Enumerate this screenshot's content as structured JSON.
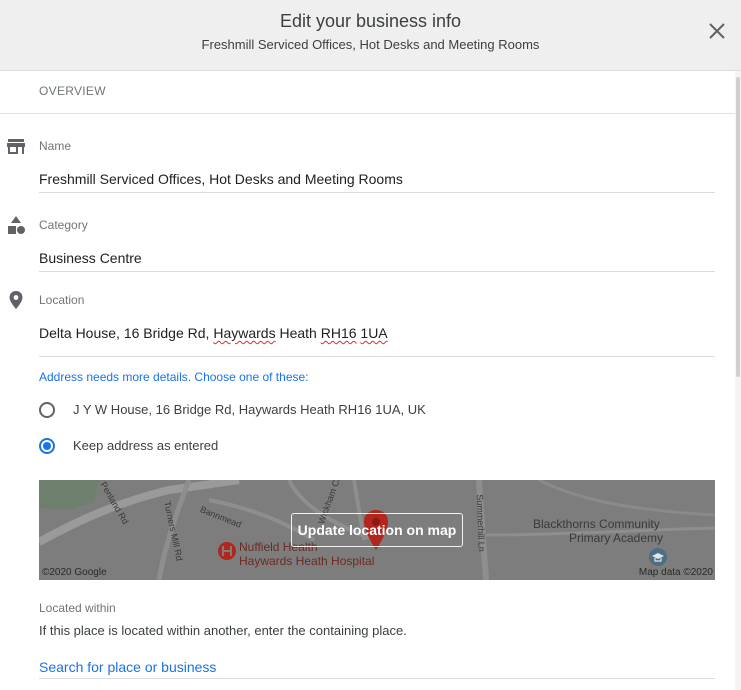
{
  "dialog": {
    "title": "Edit your business info",
    "subtitle": "Freshmill Serviced Offices, Hot Desks and Meeting Rooms",
    "close_icon": "close-icon"
  },
  "section": {
    "label": "OVERVIEW"
  },
  "name_field": {
    "label": "Name",
    "value": "Freshmill Serviced Offices, Hot Desks and Meeting Rooms",
    "icon": "storefront-icon"
  },
  "category_field": {
    "label": "Category",
    "value": "Business Centre",
    "icon": "category-shapes-icon"
  },
  "location_field": {
    "label": "Location",
    "icon": "location-pin-icon",
    "value_parts": {
      "prefix": "Delta House, 16 Bridge Rd, ",
      "town": "Haywards",
      "middle": " Heath ",
      "postcode_a": "RH16",
      "space": " ",
      "postcode_b": "1UA"
    }
  },
  "address_suggestions": {
    "hint": "Address needs more details. Choose one of these:",
    "options": [
      {
        "label": "J Y W House, 16 Bridge Rd, Haywards Heath RH16 1UA, UK",
        "selected": false
      },
      {
        "label": "Keep address as entered",
        "selected": true
      }
    ]
  },
  "map": {
    "button_label": "Update location on map",
    "copyright_left": "©2020 Google",
    "copyright_right": "Map data ©2020",
    "hospital_line1": "Nuffield Health",
    "hospital_line2": "Haywards Heath Hospital",
    "school_line1": "Blackthorns Community",
    "school_line2": "Primary Academy",
    "roads": [
      "Penland Rd",
      "Turners Mill Rd",
      "Bannmead",
      "Wickham Cl",
      "Summerhill Ln"
    ]
  },
  "located_within": {
    "label": "Located within",
    "description": "If this place is located within another, enter the containing place.",
    "placeholder": "Search for place or business"
  },
  "colors": {
    "accent": "#1a73e8",
    "header_bg": "#efefef",
    "map_overlay": "#7d7d7d",
    "pin": "#b3261e"
  }
}
